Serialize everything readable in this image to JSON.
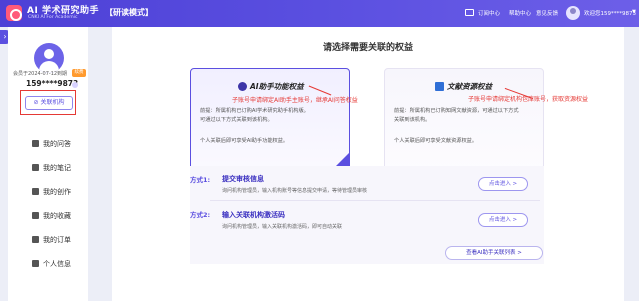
{
  "header": {
    "app_title": "AI 学术研究助手",
    "app_subtitle": "CNKI AI For Academic",
    "mode_label": "【研读模式】",
    "links": [
      "订阅中心",
      "帮助中心",
      "意见反馈"
    ],
    "user_label": "欢迎您159****9873",
    "colors": {
      "brand": "#5b4fe0",
      "logo": "#ff5a7a"
    }
  },
  "sidebar": {
    "member_until": "会员于2024-07-12到期",
    "renew_label": "续费",
    "phone": "159****9873",
    "bind_button": "关联机构",
    "nav": [
      {
        "label": "我的问答",
        "icon": "chat-icon"
      },
      {
        "label": "我的笔记",
        "icon": "note-icon"
      },
      {
        "label": "我的创作",
        "icon": "edit-icon"
      },
      {
        "label": "我的收藏",
        "icon": "star-icon"
      },
      {
        "label": "我的订单",
        "icon": "order-icon"
      },
      {
        "label": "个人信息",
        "icon": "user-icon"
      }
    ]
  },
  "main": {
    "title": "请选择需要关联的权益",
    "card_left": {
      "title": "AI助手功能权益",
      "text1": "前提：所属机构已订购AI学术研究助手机构版。",
      "text2": "可通过以下方式关联到该机构。",
      "text3": "个人关联后即可享受AI助手功能权益。"
    },
    "card_right": {
      "title": "文献资源权益",
      "text1": "前提：所属机构已订购知网文献资源，可通过以下方式",
      "text2": "关联到该机构。",
      "text3": "个人关联后即可享受文献资源权益。"
    },
    "annotations": {
      "left": "子账号申请绑定AI助手主账号，继承AI问答权益",
      "right": "子账号申请绑定机构包库账号，获取资源权益"
    },
    "methods": [
      {
        "tag": "方式1:",
        "title": "提交审核信息",
        "desc": "询问机构管理员，输入机构账号等信息提交申请，等待管理员审核",
        "button": "点击进入 >"
      },
      {
        "tag": "方式2:",
        "title": "输入关联机构激活码",
        "desc": "询问机构管理员，输入关联机构激活码，即可自动关联",
        "button": "点击进入 >"
      }
    ],
    "list_button": "查看AI助手关联列表 >"
  }
}
